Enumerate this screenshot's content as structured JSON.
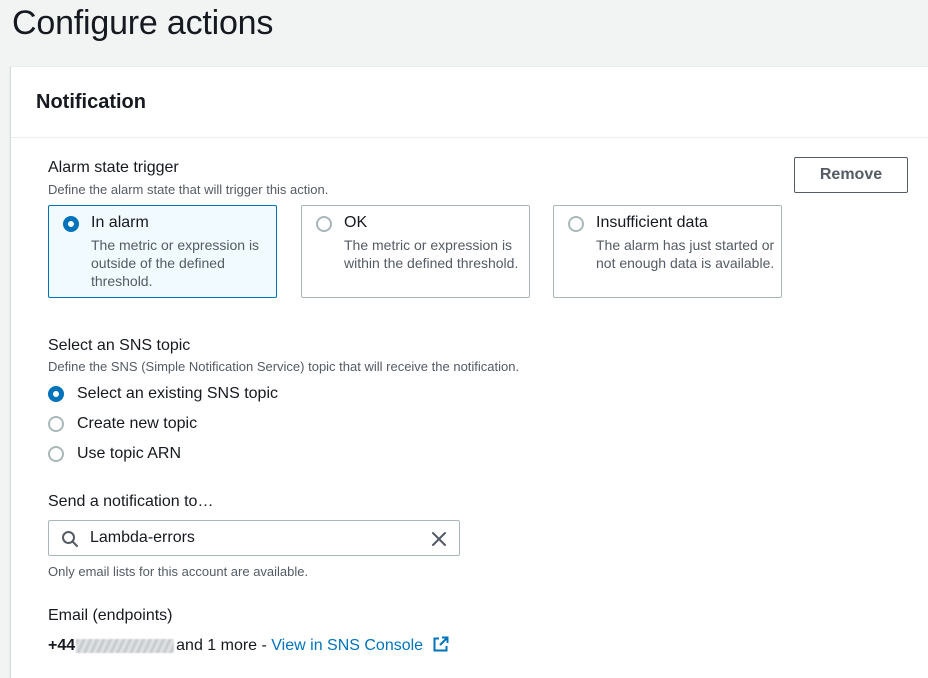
{
  "page": {
    "title": "Configure actions"
  },
  "panel": {
    "title": "Notification",
    "remove_label": "Remove"
  },
  "alarm_trigger": {
    "label": "Alarm state trigger",
    "description": "Define the alarm state that will trigger this action.",
    "options": [
      {
        "title": "In alarm",
        "description": "The metric or expression is outside of the defined threshold.",
        "selected": true
      },
      {
        "title": "OK",
        "description": "The metric or expression is within the defined threshold.",
        "selected": false
      },
      {
        "title": "Insufficient data",
        "description": "The alarm has just started or not enough data is available.",
        "selected": false
      }
    ]
  },
  "sns_topic": {
    "label": "Select an SNS topic",
    "description": "Define the SNS (Simple Notification Service) topic that will receive the notification.",
    "options": [
      {
        "label": "Select an existing SNS topic",
        "selected": true
      },
      {
        "label": "Create new topic",
        "selected": false
      },
      {
        "label": "Use topic ARN",
        "selected": false
      }
    ]
  },
  "send_to": {
    "label": "Send a notification to…",
    "value": "Lambda-errors",
    "hint": "Only email lists for this account are available."
  },
  "endpoints": {
    "label": "Email (endpoints)",
    "prefix": "+44",
    "suffix": "and 1 more - ",
    "link_label": "View in SNS Console"
  },
  "colors": {
    "accent": "#0073bb",
    "selected_tile_bg": "#f1faff",
    "text": "#16191f",
    "muted": "#545b64"
  }
}
